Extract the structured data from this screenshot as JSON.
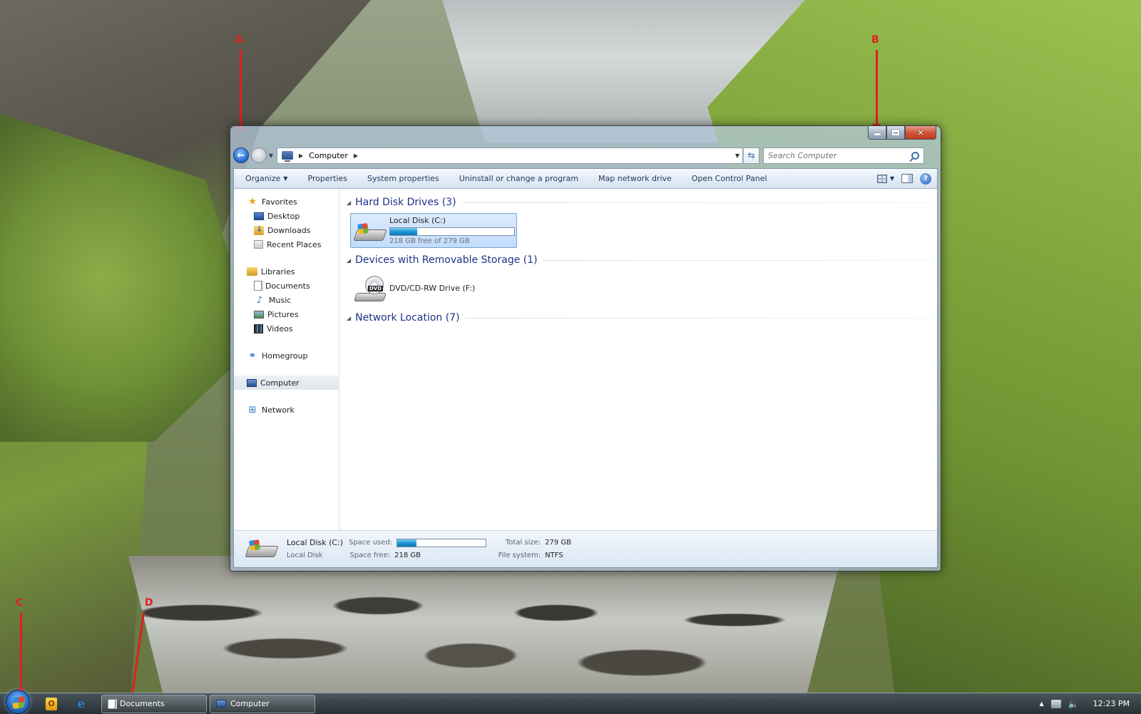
{
  "window": {
    "title": "Computer",
    "caption": {
      "minimize": "minimize",
      "maximize": "maximize",
      "close": "close"
    }
  },
  "address": {
    "crumbs": [
      "Computer"
    ],
    "search_placeholder": "Search Computer"
  },
  "toolbar": {
    "organize": "Organize",
    "properties": "Properties",
    "system_properties": "System properties",
    "uninstall": "Uninstall or change a program",
    "map_drive": "Map network drive",
    "control_panel": "Open Control Panel"
  },
  "navpane": {
    "favorites": {
      "label": "Favorites",
      "items": [
        "Desktop",
        "Downloads",
        "Recent Places"
      ]
    },
    "libraries": {
      "label": "Libraries",
      "items": [
        "Documents",
        "Music",
        "Pictures",
        "Videos"
      ]
    },
    "homegroup": "Homegroup",
    "computer": "Computer",
    "network": "Network"
  },
  "groups": {
    "hard_disks": {
      "title": "Hard Disk Drives (3)"
    },
    "removable": {
      "title": "Devices with Removable Storage (1)"
    },
    "network": {
      "title": "Network Location (7)"
    }
  },
  "drives": {
    "c": {
      "name": "Local Disk (C:)",
      "free_text": "218 GB free of 279 GB",
      "used_fraction": 0.22
    },
    "f": {
      "name": "DVD/CD-RW Drive (F:)"
    }
  },
  "details": {
    "name": "Local Disk (C:)",
    "type": "Local Disk",
    "space_used_label": "Space used:",
    "space_free_label": "Space free:",
    "space_free": "218 GB",
    "total_size_label": "Total size:",
    "total_size": "279 GB",
    "filesystem_label": "File system:",
    "filesystem": "NTFS",
    "used_fraction": 0.22
  },
  "annotations": [
    "A",
    "B",
    "C",
    "D"
  ],
  "taskbar": {
    "tasks": [
      "Documents",
      "Computer"
    ],
    "clock": "12:23 PM",
    "pinned": {
      "outlook": "O",
      "ie": "e"
    }
  },
  "colors": {
    "accent": "#1e3287",
    "selection": "#c1dcfc",
    "bar_fill": "#1e94d6"
  }
}
